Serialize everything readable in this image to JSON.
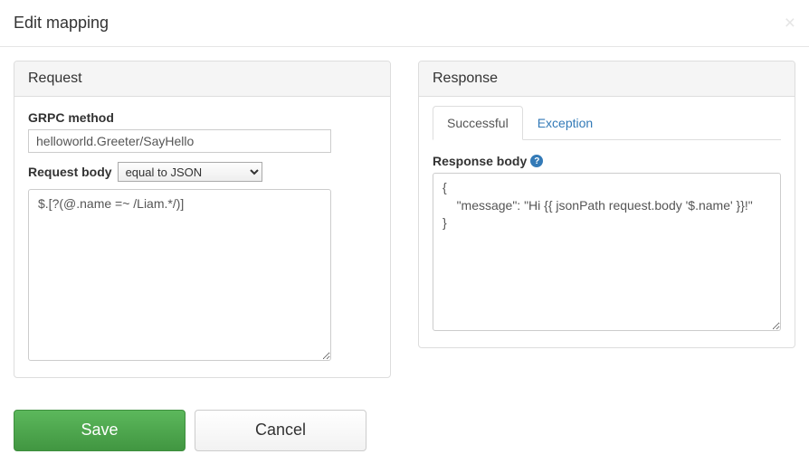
{
  "header": {
    "title": "Edit mapping"
  },
  "request": {
    "panel_title": "Request",
    "grpc_method_label": "GRPC method",
    "grpc_method_value": "helloworld.Greeter/SayHello",
    "request_body_label": "Request body",
    "body_match_selected": "equal to JSON",
    "body_pattern_value": "$.[?(@.name =~ /Liam.*/)]"
  },
  "response": {
    "panel_title": "Response",
    "tabs": {
      "successful": "Successful",
      "exception": "Exception"
    },
    "response_body_label": "Response body",
    "response_body_value": "{\n    \"message\": \"Hi {{ jsonPath request.body '$.name' }}!\"\n}"
  },
  "actions": {
    "save": "Save",
    "cancel": "Cancel"
  }
}
